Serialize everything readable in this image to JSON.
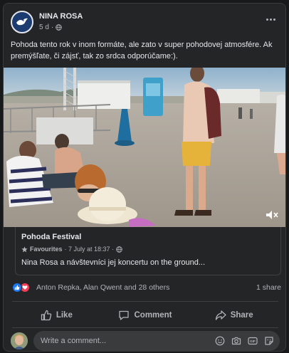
{
  "post": {
    "author": "NINA ROSA",
    "time": "5 d",
    "audience_icon": "globe-icon",
    "caption": "Pohoda tento rok v inom formáte, ale zato v super pohodovej atmosfére. Ak premýšľate, či zájsť, tak zo srdca odporúčame:)."
  },
  "video": {
    "muted": true,
    "description": "festival grounds video frame"
  },
  "link": {
    "title": "Pohoda Festival",
    "favourites": "Favourites",
    "date": "· 7 July at 18:37 ·",
    "description": "Nina Rosa a návštevníci jej koncertu on the ground..."
  },
  "reactions": {
    "icons": [
      "like-icon",
      "love-icon"
    ],
    "text": "Anton Repka, Alan Qwent and 28 others",
    "shares": "1 share"
  },
  "actions": {
    "like": "Like",
    "comment": "Comment",
    "share": "Share"
  },
  "comment_box": {
    "placeholder": "Write a comment..."
  },
  "colors": {
    "background": "#18191a",
    "card": "#242526",
    "text_primary": "#e4e6eb",
    "text_secondary": "#b0b3b8",
    "like_blue": "#1877f2",
    "love_red": "#f33e58"
  }
}
